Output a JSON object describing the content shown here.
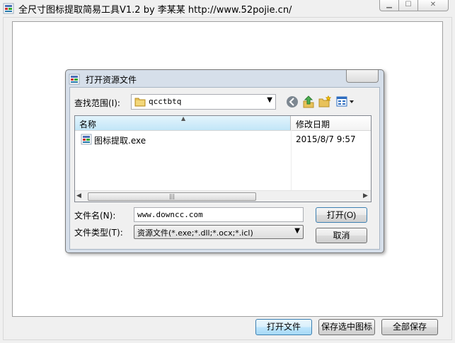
{
  "window": {
    "title": "全尺寸图标提取简易工具V1.2 by 李某某    http://www.52pojie.cn/"
  },
  "buttons": {
    "open_file": "打开文件",
    "save_selected": "保存选中图标",
    "save_all": "全部保存"
  },
  "dialog": {
    "title": "打开资源文件",
    "look_in_label": "查找范围(I):",
    "look_in_value": "qcctbtq",
    "columns": {
      "name": "名称",
      "date": "修改日期"
    },
    "files": [
      {
        "name": "图标提取.exe",
        "date": "2015/8/7 9:57"
      }
    ],
    "file_name_label": "文件名(N):",
    "file_name_value": "www.downcc.com",
    "file_type_label": "文件类型(T):",
    "file_type_value": "资源文件(*.exe;*.dll;*.ocx;*.icl)",
    "open_label": "打开(O)",
    "cancel_label": "取消"
  },
  "colors": {
    "accent_border": "#3c7fb1",
    "dialog_frame": "#d6dfea",
    "folder": "#e8c25a"
  }
}
